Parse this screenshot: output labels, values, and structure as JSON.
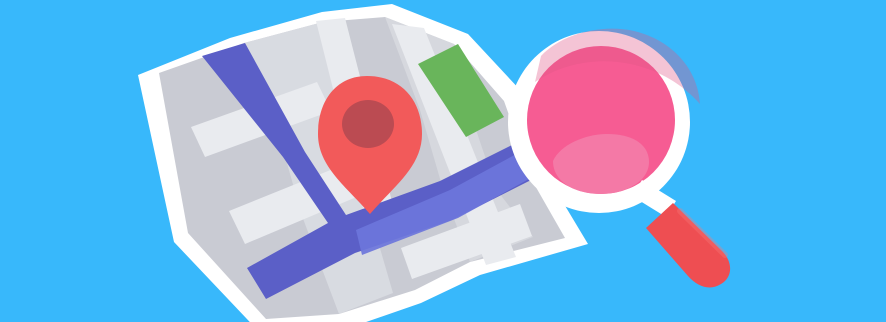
{
  "illustration": {
    "subject": "folded-map-with-location-pin-and-magnifying-glass",
    "icons": [
      "map-icon",
      "location-pin-icon",
      "magnifying-glass-icon"
    ],
    "colors": {
      "background": "#38b8fb",
      "map_paper": "#c9cbd3",
      "map_fold_light": "#d9dbe1",
      "map_outline": "#ffffff",
      "road_main": "#5b5fc7",
      "road_secondary": "#e9ebef",
      "park_green": "#69b55b",
      "pin_red": "#f25a5a",
      "pin_center": "#bb4b52",
      "lens_pink": "#f65c93",
      "lens_rim": "#ffffff",
      "handle_red": "#ee4e52"
    }
  }
}
